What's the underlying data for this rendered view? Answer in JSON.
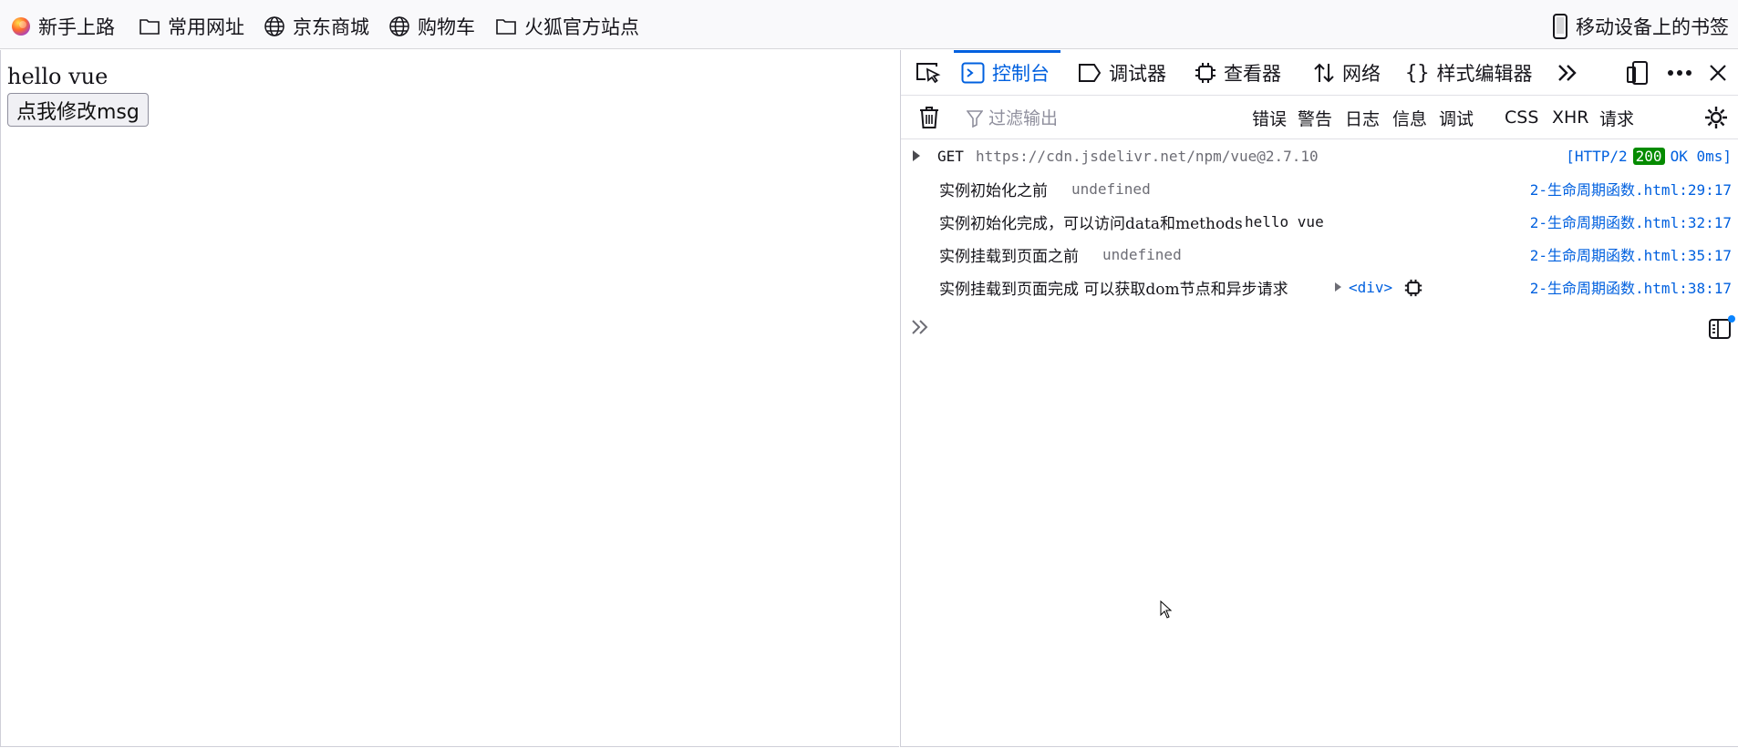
{
  "bookmarks": {
    "items": [
      {
        "label": "新手上路",
        "icon": "firefox-icon"
      },
      {
        "label": "常用网址",
        "icon": "folder-icon"
      },
      {
        "label": "京东商城",
        "icon": "globe-icon"
      },
      {
        "label": "购物车",
        "icon": "globe-icon"
      },
      {
        "label": "火狐官方站点",
        "icon": "folder-icon"
      }
    ],
    "mobile": {
      "label": "移动设备上的书签",
      "icon": "mobile-phone-icon"
    }
  },
  "page": {
    "message": "hello vue",
    "button_label": "点我修改msg"
  },
  "devtools": {
    "tabs": [
      {
        "label": "控制台",
        "icon": "console-icon",
        "active": true
      },
      {
        "label": "调试器",
        "icon": "debugger-icon"
      },
      {
        "label": "查看器",
        "icon": "inspector-icon"
      },
      {
        "label": "网络",
        "icon": "network-icon"
      },
      {
        "label": "样式编辑器",
        "icon": "style-editor-icon"
      }
    ],
    "filter": {
      "placeholder": "过滤输出",
      "value": ""
    },
    "levels": [
      "错误",
      "警告",
      "日志",
      "信息",
      "调试"
    ],
    "types": [
      "CSS",
      "XHR",
      "请求"
    ],
    "accent": "#0060df",
    "messages": [
      {
        "method": "GET",
        "url": "https://cdn.jsdelivr.net/npm/vue@2.7.10",
        "status_prefix": "[HTTP/2",
        "status_code": "200",
        "status_suffix": "OK 0ms]"
      },
      {
        "text": "实例初始化之前",
        "value": "undefined",
        "source": "2-生命周期函数.html:29:17"
      },
      {
        "text": "实例初始化完成，可以访问data和methods",
        "value": "hello vue",
        "source": "2-生命周期函数.html:32:17"
      },
      {
        "text": "实例挂载到页面之前",
        "value": "undefined",
        "source": "2-生命周期函数.html:35:17"
      },
      {
        "text": "实例挂载到页面完成 可以获取dom节点和异步请求",
        "value": "<div>",
        "source": "2-生命周期函数.html:38:17"
      }
    ],
    "status_color": "#058b00"
  }
}
